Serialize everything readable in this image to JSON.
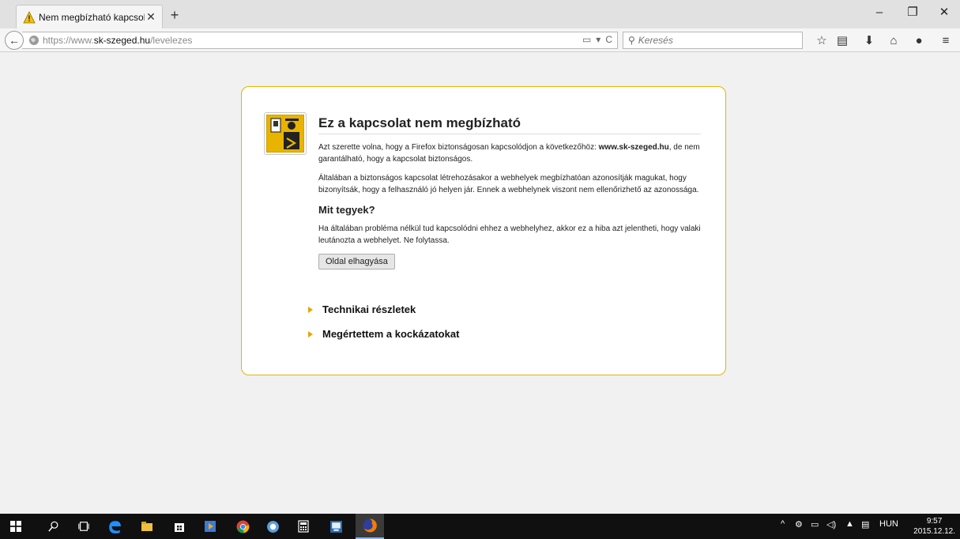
{
  "browser": {
    "tab_title": "Nem megbízható kapcsolat",
    "tab_close": "✕",
    "new_tab": "+",
    "window_controls": {
      "minimize": "‒",
      "restore": "❐",
      "close": "✕"
    }
  },
  "navbar": {
    "back": "←",
    "url_prefix": "https://www.",
    "url_domain": "sk-szeged.hu",
    "url_path": "/levelezes",
    "reader_icon": "reader-icon",
    "reload": "C",
    "search_placeholder": "Keresés"
  },
  "toolbar_icons": [
    "star-icon",
    "bookmarks-list-icon",
    "download-icon",
    "home-icon",
    "hello-icon",
    "menu-icon"
  ],
  "error_page": {
    "title": "Ez a kapcsolat nem megbízható",
    "para1_pre": "Azt szerette volna, hogy a Firefox biztonságosan kapcsolódjon a következőhöz: ",
    "para1_host": "www.sk-szeged.hu",
    "para1_post": ", de nem garantálható, hogy a kapcsolat biztonságos.",
    "para2": "Általában a biztonságos kapcsolat létrehozásakor a webhelyek megbízhatóan azonosítják magukat, hogy bizonyítsák, hogy a felhasználó jó helyen jár. Ennek a webhelynek viszont nem ellenőrizhető az azonossága.",
    "heading2": "Mit tegyek?",
    "para3": "Ha általában probléma nélkül tud kapcsolódni ehhez a webhelyhez, akkor ez a hiba azt jelentheti, hogy valaki leutánozta a webhelyet. Ne folytassa.",
    "leave_button": "Oldal elhagyása",
    "technical_details": "Technikai részletek",
    "understand_risks": "Megértettem a kockázatokat"
  },
  "taskbar": {
    "language": "HUN",
    "time": "9:57",
    "date": "2015.12.12."
  },
  "colors": {
    "accent_yellow": "#e8b400",
    "taskbar": "#101010",
    "page_bg": "#f1f1f1"
  }
}
